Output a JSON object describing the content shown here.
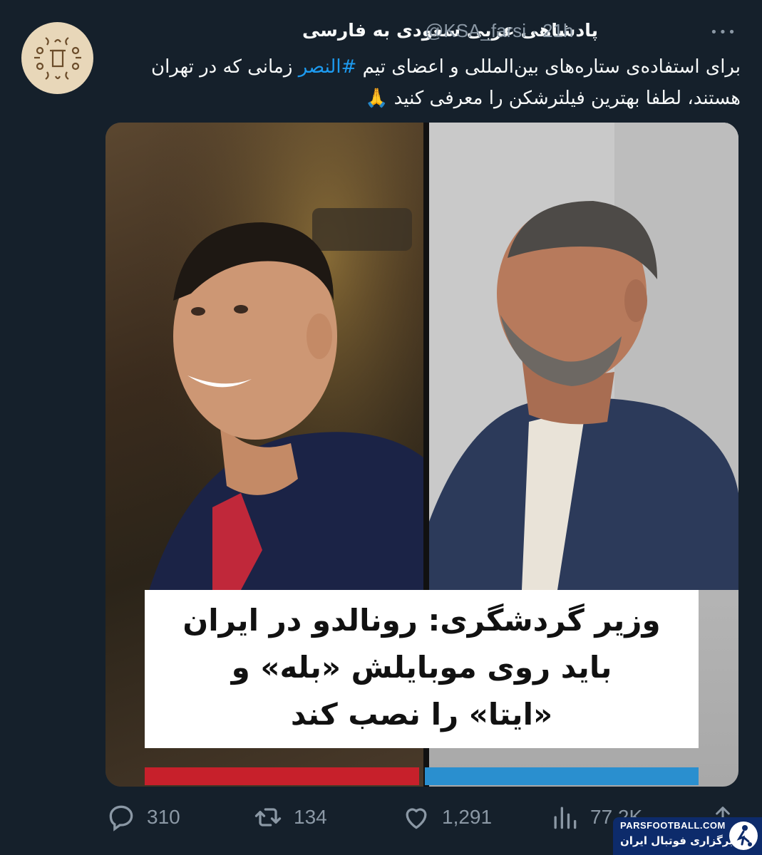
{
  "tweet": {
    "display_name": "پادشاهی عربی سعودی به فارسی",
    "handle": "@KSA_farsi",
    "separator": "·",
    "time": "21h",
    "more_label": "•••",
    "text_part1": "برای استفاده‌ی ستاره‌های بین‌المللی و اعضای تیم",
    "hashtag": "#النصر",
    "text_part2": "زمانی که در تهران هستند، لطفا بهترین فیلترشکن را معرفی کنید",
    "emoji": "🙏"
  },
  "media": {
    "caption_line1": "وزیر گردشگری: رونالدو در ایران",
    "caption_line2": "باید روی موبایلش «بله» و",
    "caption_line3": "«ایتا» را نصب کند",
    "accent_red": "#c7202b",
    "accent_blue": "#2a8fcf"
  },
  "actions": {
    "replies": "310",
    "retweets": "134",
    "likes": "1,291",
    "views": "77.2K"
  },
  "watermark": {
    "brand": "PARSFOOTBALL.COM",
    "label": "خبرگزاری فوتبال ایران"
  },
  "colors": {
    "background": "#15202b",
    "text": "#f7f9f9",
    "secondary": "#8b98a5",
    "link": "#1d9bf0"
  }
}
